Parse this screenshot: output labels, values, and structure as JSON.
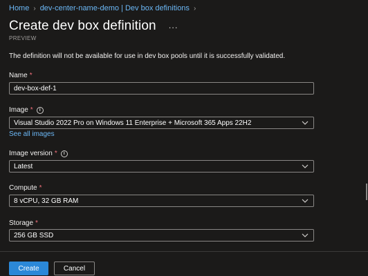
{
  "breadcrumb": {
    "items": [
      "Home",
      "dev-center-name-demo | Dev box definitions"
    ]
  },
  "header": {
    "title": "Create dev box definition",
    "more_label": "...",
    "subtitle": "PREVIEW"
  },
  "info_text": "The definition will not be available for use in dev box pools until it is successfully validated.",
  "form": {
    "name": {
      "label": "Name",
      "required": "*",
      "value": "dev-box-def-1"
    },
    "image": {
      "label": "Image",
      "required": "*",
      "value": "Visual Studio 2022 Pro on Windows 11 Enterprise + Microsoft 365 Apps 22H2",
      "link": "See all images"
    },
    "image_version": {
      "label": "Image version",
      "required": "*",
      "value": "Latest"
    },
    "compute": {
      "label": "Compute",
      "required": "*",
      "value": "8 vCPU, 32 GB RAM"
    },
    "storage": {
      "label": "Storage",
      "required": "*",
      "value": "256 GB SSD"
    }
  },
  "footer": {
    "create_label": "Create",
    "cancel_label": "Cancel"
  },
  "colors": {
    "background": "#1b1a19",
    "link": "#6cb8f6",
    "primary_button": "#2b88d8",
    "required_star": "#f1707b"
  },
  "icons": {
    "info": "info-icon",
    "chevron": "chevron-down-icon",
    "breadcrumb_separator": "chevron-right-icon",
    "more": "more-icon"
  }
}
